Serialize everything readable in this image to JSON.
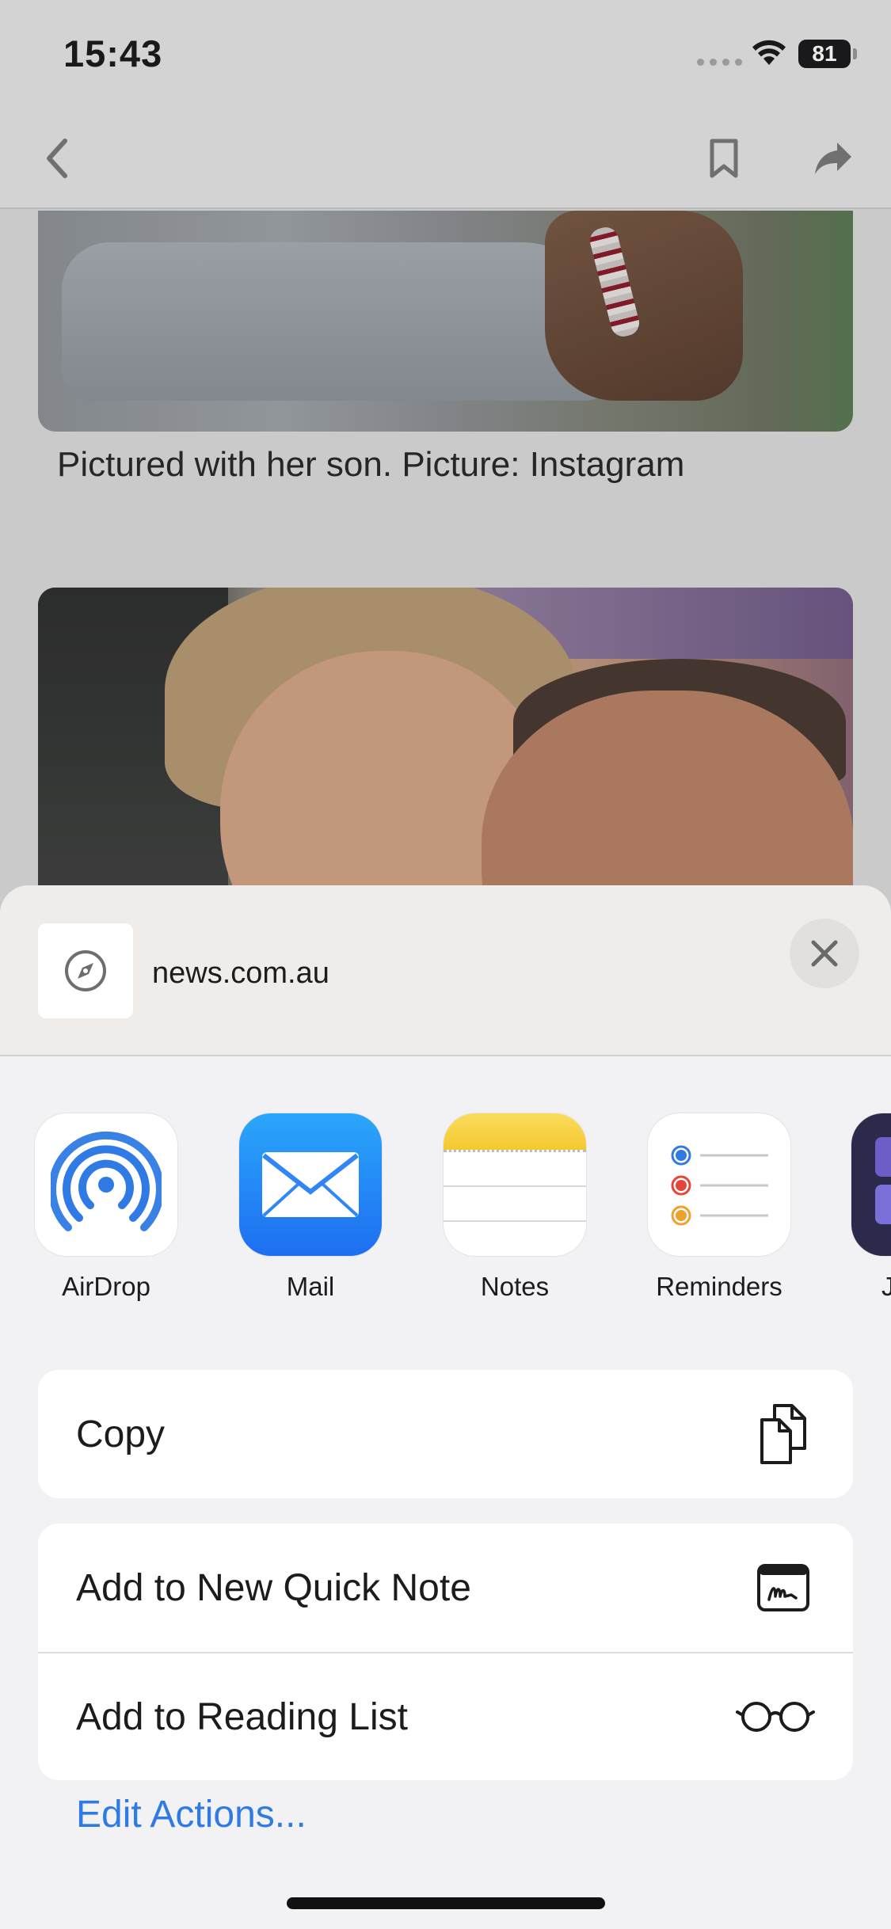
{
  "status_bar": {
    "time": "15:43",
    "battery": "81"
  },
  "nav": {
    "back_icon": "chevron-left-icon",
    "bookmark_icon": "bookmark-icon",
    "share_icon": "share-arrow-icon"
  },
  "article": {
    "caption": "Pictured with her son. Picture: Instagram"
  },
  "share_sheet": {
    "site": "news.com.au",
    "site_icon": "compass-icon",
    "close_icon": "close-icon",
    "apps": [
      {
        "label": "AirDrop",
        "icon": "airdrop-icon"
      },
      {
        "label": "Mail",
        "icon": "mail-icon"
      },
      {
        "label": "Notes",
        "icon": "notes-icon"
      },
      {
        "label": "Reminders",
        "icon": "reminders-icon"
      },
      {
        "label": "J",
        "icon": "app-icon"
      }
    ],
    "actions": {
      "copy": "Copy",
      "quick_note": "Add to New Quick Note",
      "reading_list": "Add to Reading List"
    },
    "edit_actions": "Edit Actions..."
  },
  "colors": {
    "accent": "#2f7ae5",
    "mail_blue": "#2f86f4",
    "notes_yellow": "#f7d13f",
    "reminder_blue": "#2f7ae5",
    "reminder_red": "#e5463a",
    "reminder_orange": "#f0a12b"
  }
}
